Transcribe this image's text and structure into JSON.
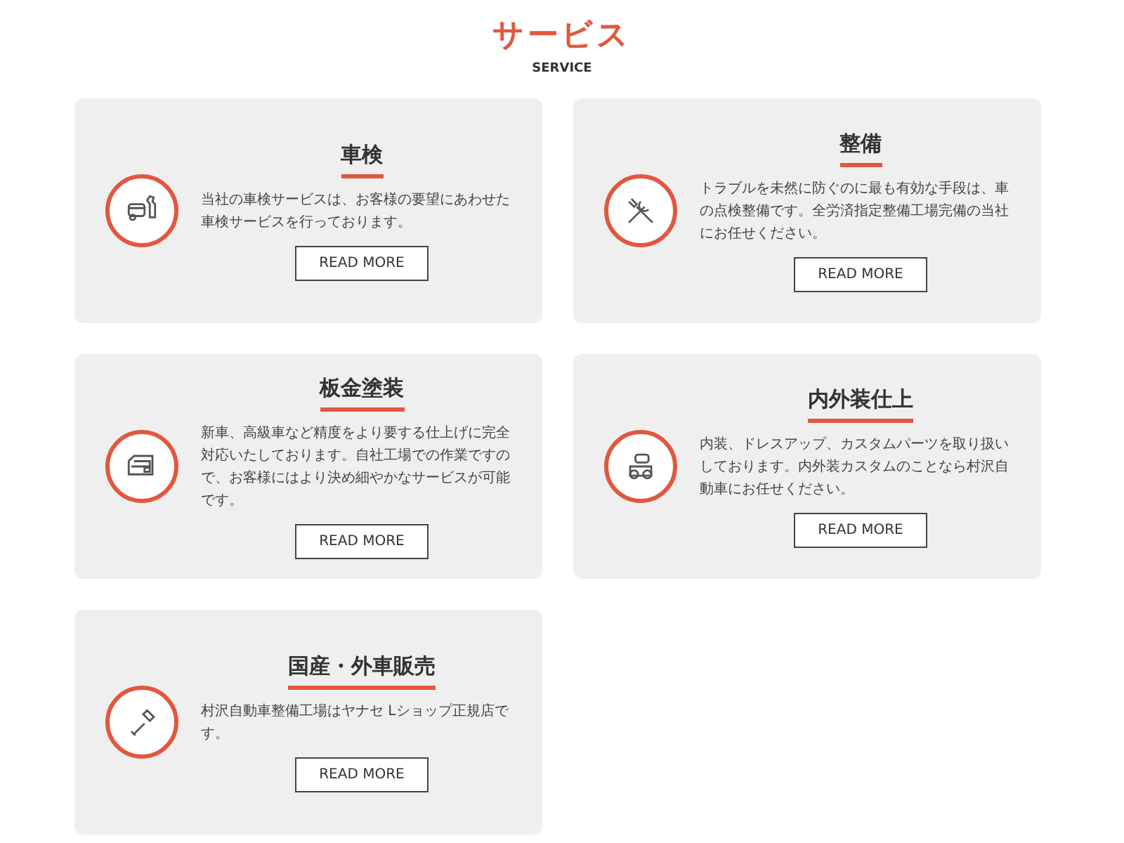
{
  "header": {
    "title": "サービス",
    "subtitle": "SERVICE"
  },
  "services": [
    {
      "kind": "inspection",
      "title": "車検",
      "text": "当社の車検サービスは、お客様の要望にあわせた車検サービスを行っております。",
      "button": "READ MORE"
    },
    {
      "kind": "repair",
      "title": "整備",
      "text": "トラブルを未然に防ぐのに最も有効な手段は、車の点検整備です。全労済指定整備工場完備の当社にお任せください。",
      "button": "READ MORE"
    },
    {
      "kind": "body",
      "title": "板金塗装",
      "text": "新車、高級車など精度をより要する仕上げに完全対応いたしております。自社工場での作業ですので、お客様にはより決め細やかなサービスが可能です。",
      "button": "READ MORE"
    },
    {
      "kind": "custom",
      "title": "内外装仕上",
      "text": "内装、ドレスアップ、カスタムパーツを取り扱いしております。内外装カスタムのことなら村沢自動車にお任せください。",
      "button": "READ MORE"
    },
    {
      "kind": "key",
      "title": "国産・外車販売",
      "text": "村沢自動車整備工場はヤナセ Lショップ正規店です。",
      "button": "READ MORE"
    }
  ]
}
